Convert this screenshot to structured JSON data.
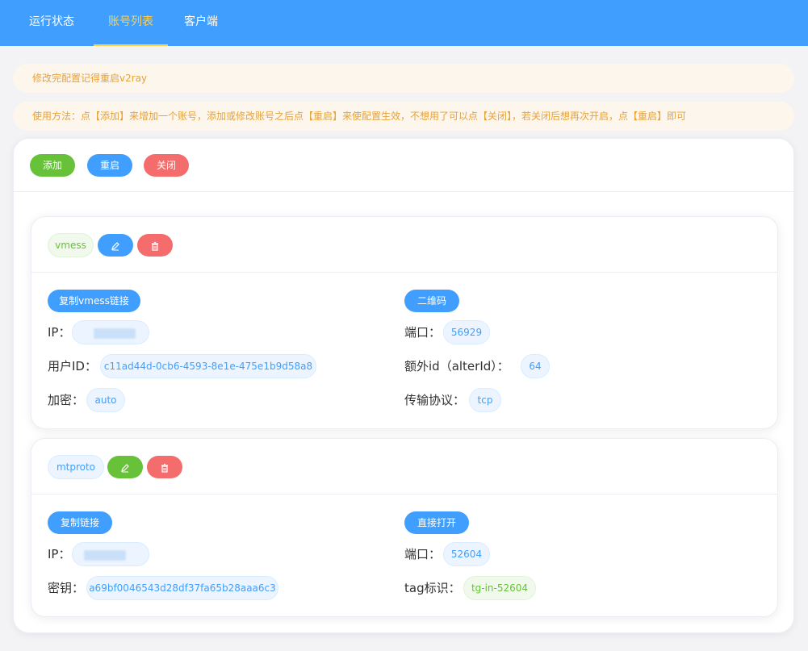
{
  "nav": {
    "tabs": [
      {
        "label": "运行状态"
      },
      {
        "label": "账号列表",
        "active": true
      },
      {
        "label": "客户端"
      }
    ]
  },
  "alerts": {
    "restart_tip": "修改完配置记得重启v2ray",
    "usage_tip": "使用方法：点【添加】来增加一个账号，添加或修改账号之后点【重启】来使配置生效，不想用了可以点【关闭】，若关闭后想再次开启，点【重启】即可"
  },
  "toolbar": {
    "add_label": "添加",
    "restart_label": "重启",
    "close_label": "关闭"
  },
  "accounts": [
    {
      "protocol": "vmess",
      "copy_label": "复制vmess链接",
      "qr_label": "二维码",
      "fields": {
        "ip_label": "IP：",
        "port_label": "端口：",
        "port": "56929",
        "uid_label": "用户ID：",
        "uid": "c11ad44d-0cb6-4593-8e1e-475e1b9d58a8",
        "alter_label": "额外id（alterId）：",
        "alter": "64",
        "enc_label": "加密：",
        "enc": "auto",
        "transport_label": "传输协议：",
        "transport": "tcp"
      }
    },
    {
      "protocol": "mtproto",
      "copy_label": "复制链接",
      "open_label": "直接打开",
      "fields": {
        "ip_label": "IP：",
        "port_label": "端口：",
        "port": "52604",
        "secret_label": "密钥：",
        "secret": "a69bf0046543d28df37fa65b28aaa6c3",
        "tag_label": "tag标识：",
        "tag": "tg-in-52604"
      }
    }
  ],
  "colors": {
    "primary": "#409eff",
    "success": "#67c23a",
    "danger": "#f56c6c",
    "warning": "#e6a23c",
    "nav_active": "#ffd04b"
  }
}
